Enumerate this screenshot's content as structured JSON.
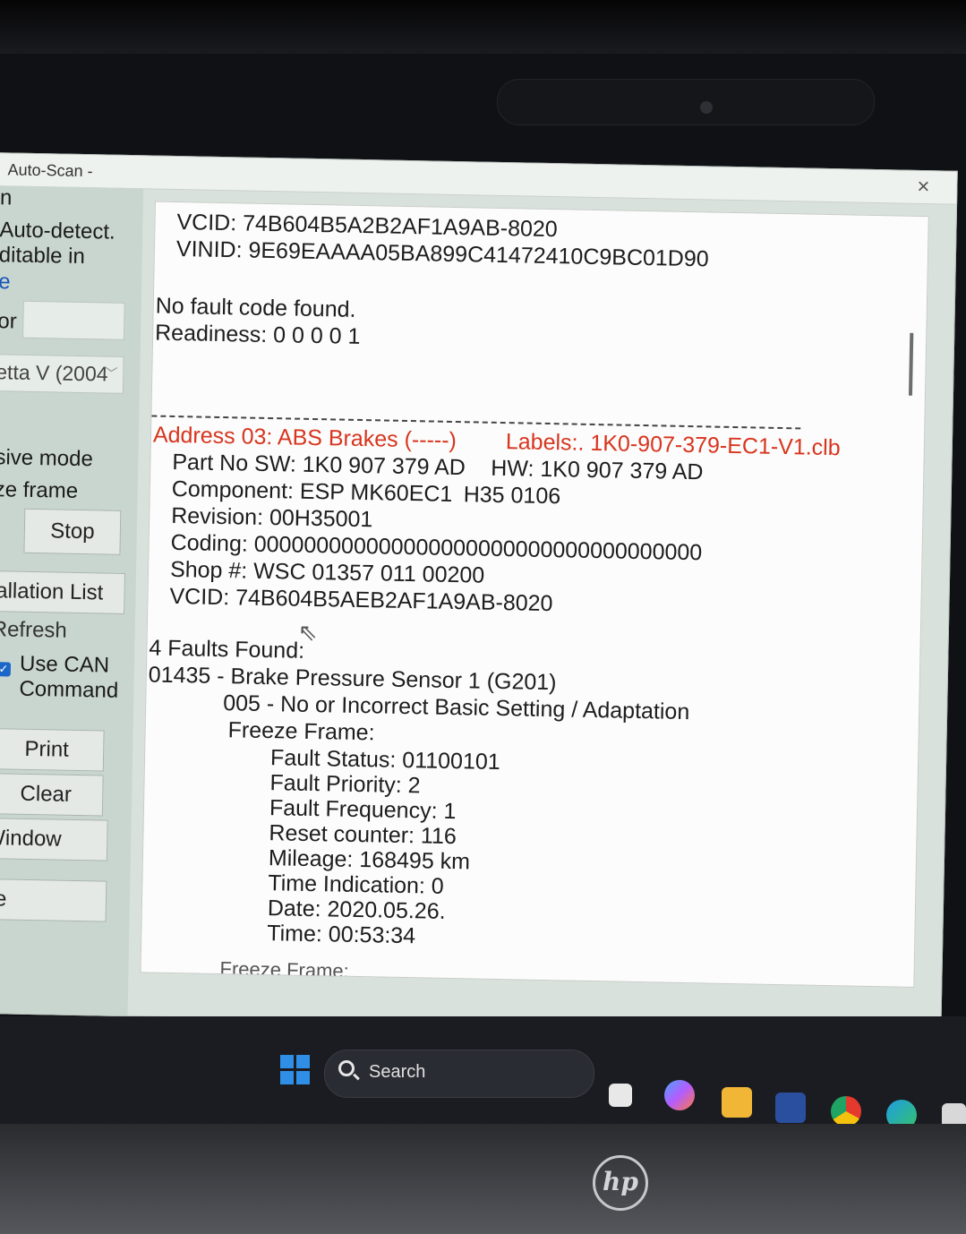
{
  "window": {
    "title": "Auto-Scan -",
    "close_label": "×"
  },
  "left_panel": {
    "t1": "n",
    "t2": "Auto-detect.",
    "t3": "ditable in",
    "t4": "e",
    "t5": "or",
    "select_value": "etta V (2004",
    "t6": "sive mode",
    "t7": "ze frame",
    "stop": "Stop",
    "install_list": "tallation List",
    "refresh": "Refresh",
    "use_can_1": "Use CAN",
    "use_can_2": "Command",
    "print": "Print",
    "clear": "Clear",
    "window_btn": "Window",
    "close_btn": "se"
  },
  "log": {
    "vcid1": "VCID: 74B604B5A2B2AF1A9AB-8020",
    "vinid": "VINID: 9E69EAAAA05BA899C41472410C9BC01D90",
    "no_fault": "No fault code found.",
    "readiness": "Readiness: 0 0 0 0 1",
    "address": "Address 03: ABS Brakes (-----)",
    "labels": "Labels:. 1K0-907-379-EC1-V1.clb",
    "part_no": "Part No SW: 1K0 907 379 AD",
    "hw": "HW: 1K0 907 379 AD",
    "component": "Component: ESP MK60EC1",
    "component_ver": "H35 0106",
    "revision": "Revision: 00H35001",
    "coding": "Coding: 000000000000000000000000000000000000",
    "shop": "Shop #: WSC 01357 011 00200",
    "vcid2": "VCID: 74B604B5AEB2AF1A9AB-8020",
    "faults_found": "4 Faults Found:",
    "fault_code": "01435 - Brake Pressure Sensor 1 (G201)",
    "fault_desc": "005 - No or Incorrect Basic Setting / Adaptation",
    "freeze_frame": "Freeze Frame:",
    "fault_status": "Fault Status: 01100101",
    "fault_priority": "Fault Priority: 2",
    "fault_frequency": "Fault Frequency: 1",
    "reset_counter": "Reset counter: 116",
    "mileage": "Mileage: 168495 km",
    "time_indication": "Time Indication: 0",
    "date": "Date: 2020.05.26.",
    "time": "Time: 00:53:34",
    "freeze_frame2": "Freeze Frame:"
  },
  "taskbar": {
    "search_label": "Search"
  },
  "brand": "hp",
  "colors": {
    "accent_red": "#d8351f",
    "windows_blue": "#2f8fe6"
  }
}
